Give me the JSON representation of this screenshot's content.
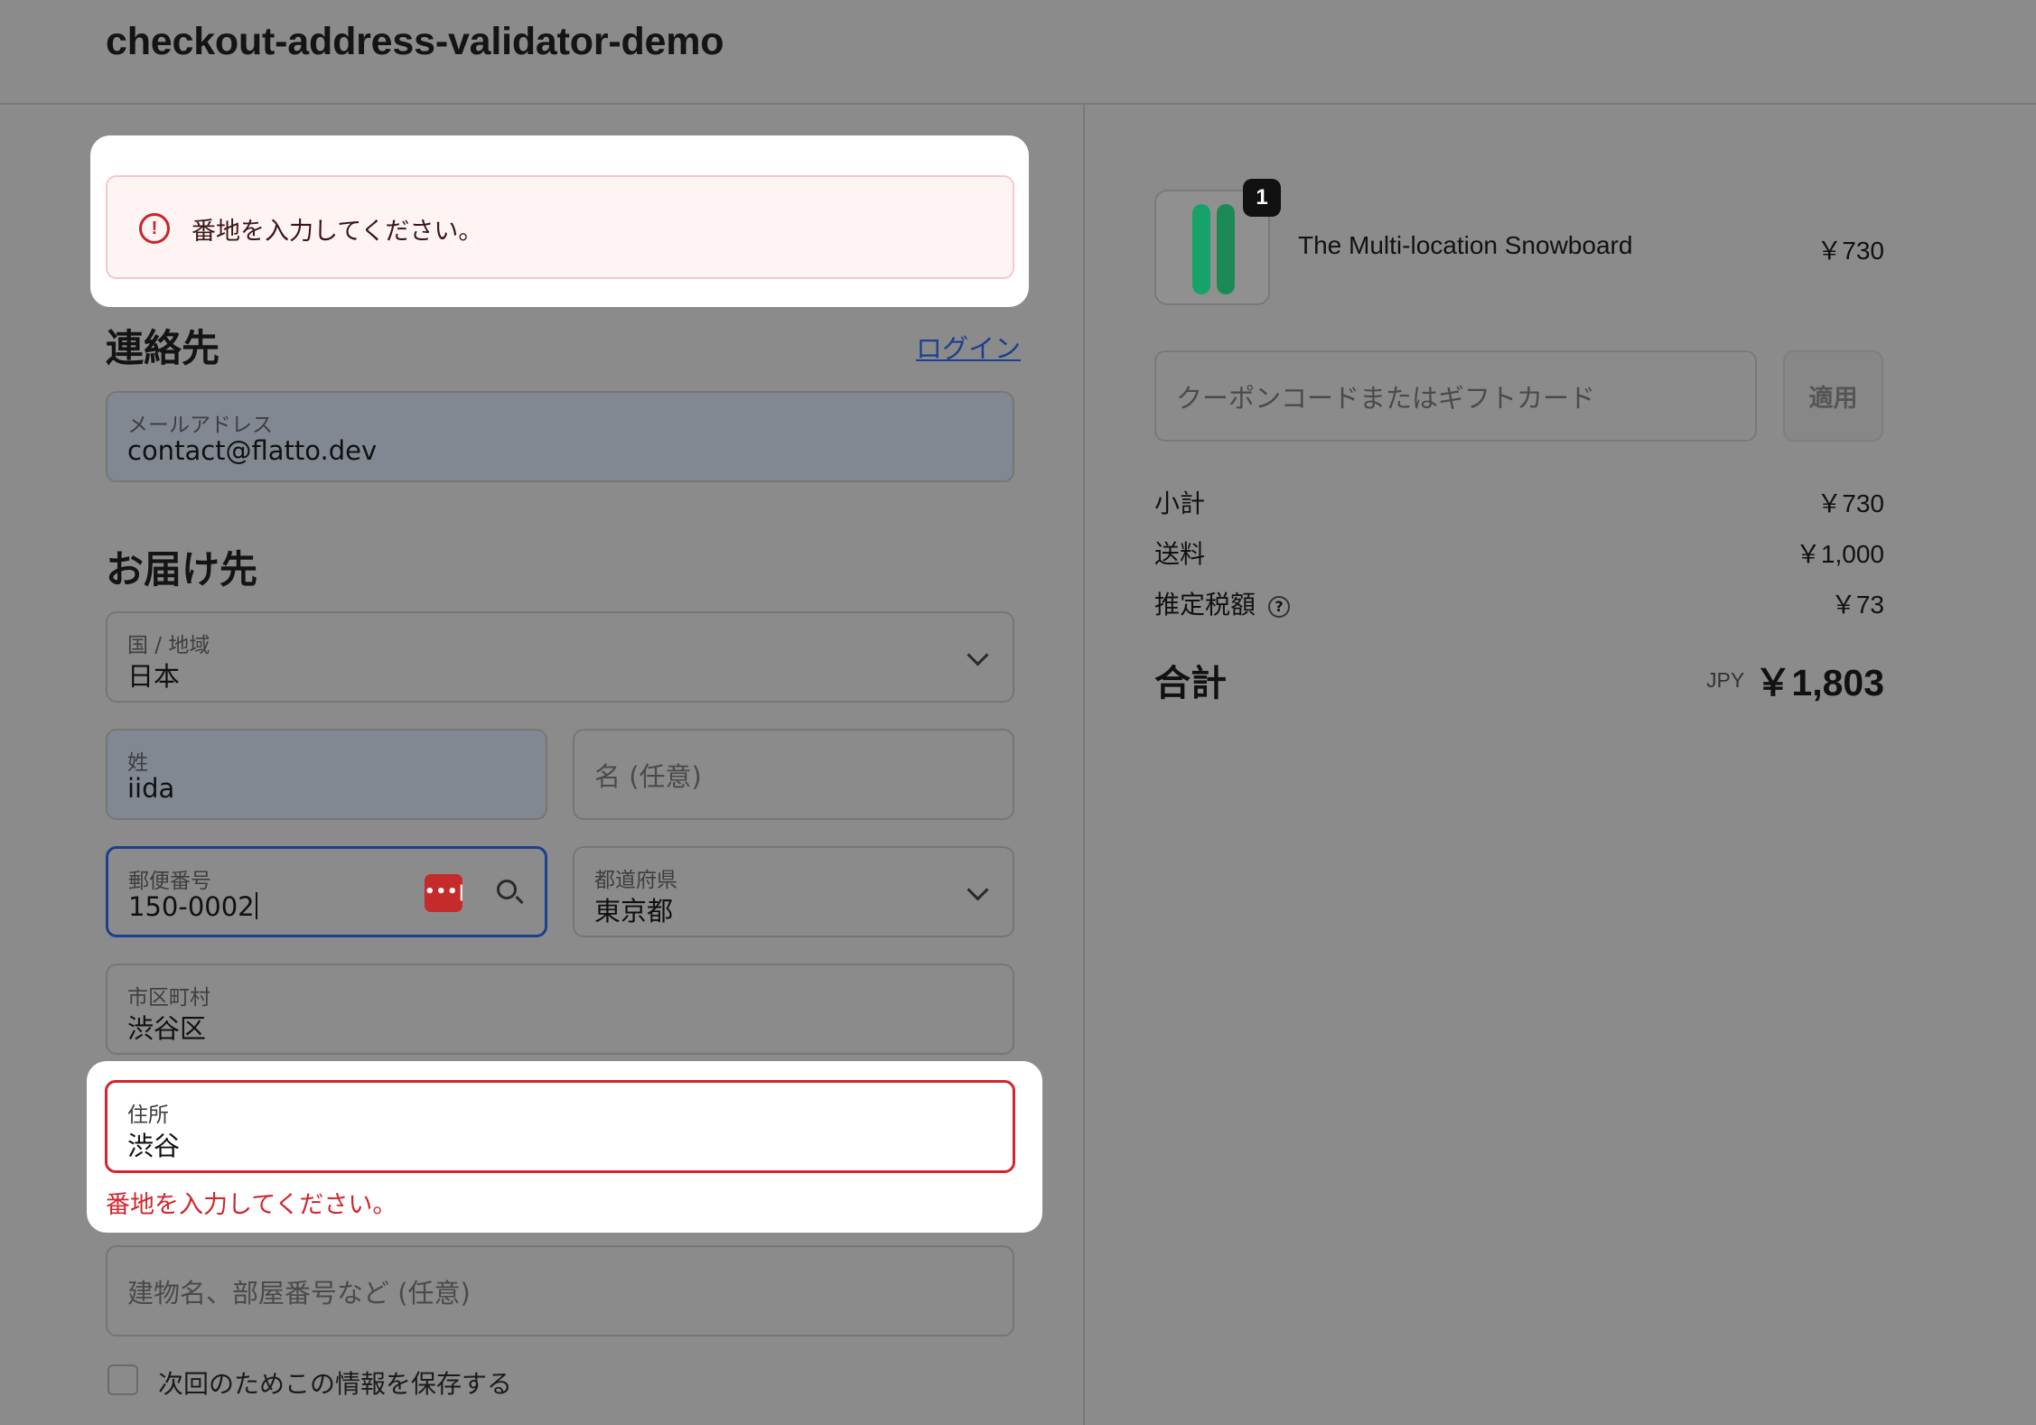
{
  "header": {
    "store_name": "checkout-address-validator-demo"
  },
  "banner": {
    "message": "番地を入力してください。",
    "icon": "alert-circle-icon"
  },
  "contact": {
    "title": "連絡先",
    "login_link": "ログイン",
    "email": {
      "label": "メールアドレス",
      "value": "contact@flatto.dev"
    }
  },
  "delivery": {
    "title": "お届け先",
    "country": {
      "label": "国 / 地域",
      "value": "日本"
    },
    "last_name": {
      "label": "姓",
      "value": "iida"
    },
    "first_name": {
      "placeholder": "名 (任意)"
    },
    "postal_code": {
      "label": "郵便番号",
      "value": "150-0002"
    },
    "prefecture": {
      "label": "都道府県",
      "value": "東京都"
    },
    "city": {
      "label": "市区町村",
      "value": "渋谷区"
    },
    "address": {
      "label": "住所",
      "value": "渋谷",
      "error": "番地を入力してください。"
    },
    "building": {
      "placeholder": "建物名、部屋番号など (任意)"
    },
    "save_info": {
      "label": "次回のためこの情報を保存する",
      "checked": false
    }
  },
  "summary": {
    "product": {
      "name": "The Multi-location Snowboard",
      "price": "￥730",
      "quantity": "1"
    },
    "coupon": {
      "placeholder": "クーポンコードまたはギフトカード",
      "apply_label": "適用"
    },
    "subtotal": {
      "label": "小計",
      "value": "￥730"
    },
    "shipping": {
      "label": "送料",
      "value": "￥1,000"
    },
    "tax": {
      "label": "推定税額",
      "value": "￥73"
    },
    "total": {
      "label": "合計",
      "currency": "JPY",
      "value": "￥1,803"
    }
  },
  "colors": {
    "error": "#d0262c",
    "link": "#1d3f8f",
    "focus": "#1d3f8f"
  }
}
